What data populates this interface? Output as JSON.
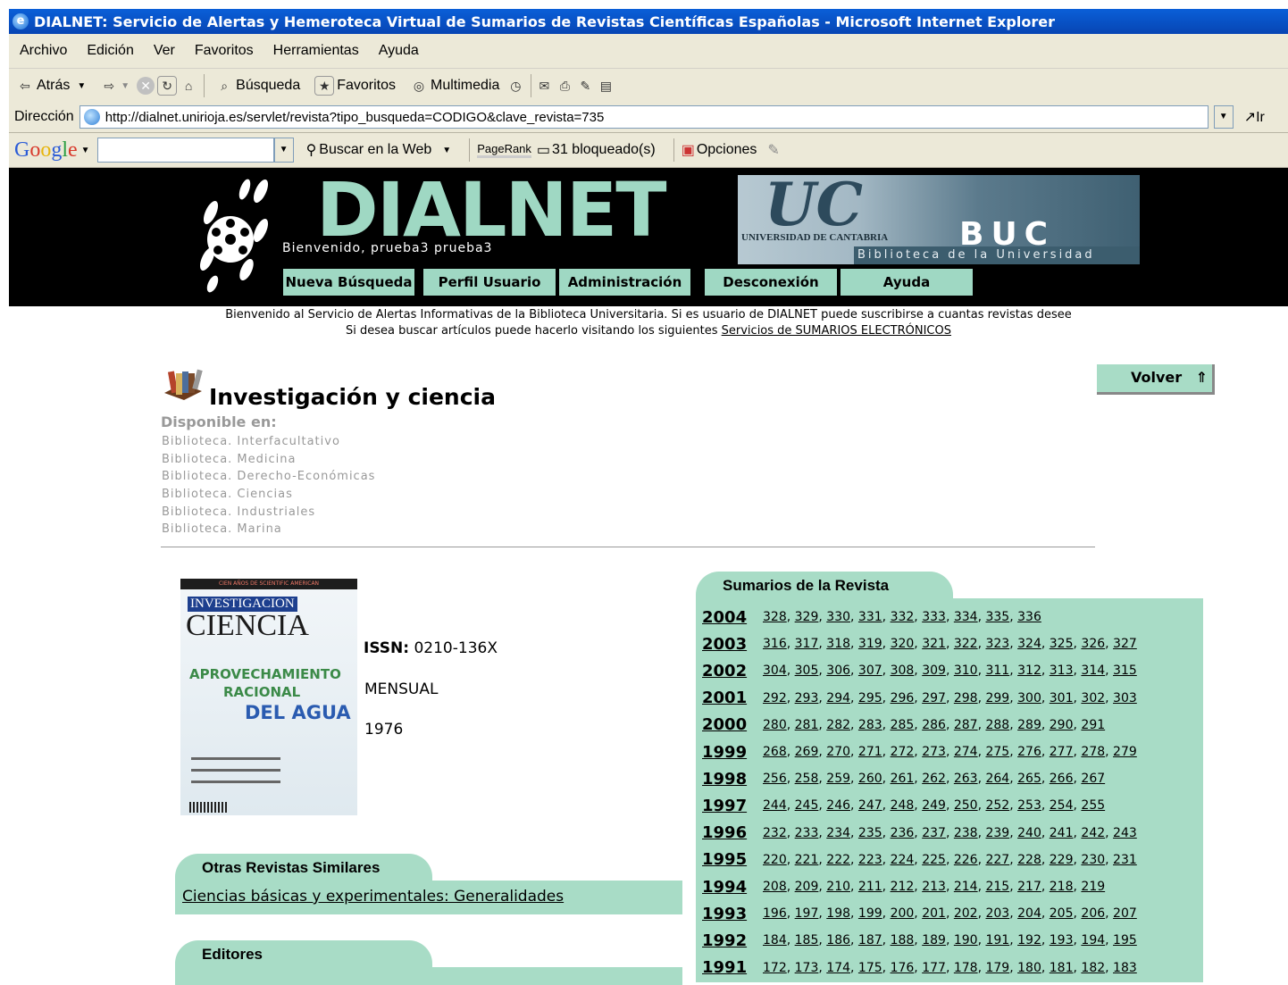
{
  "window": {
    "title": "DIALNET: Servicio de Alertas y Hemeroteca Virtual de Sumarios de Revistas Científicas Españolas - Microsoft Internet Explorer"
  },
  "menu": [
    "Archivo",
    "Edición",
    "Ver",
    "Favoritos",
    "Herramientas",
    "Ayuda"
  ],
  "toolbar": {
    "back": "Atrás",
    "search": "Búsqueda",
    "favorites": "Favoritos",
    "multimedia": "Multimedia"
  },
  "address": {
    "label": "Dirección",
    "url": "http://dialnet.unirioja.es/servlet/revista?tipo_busqueda=CODIGO&clave_revista=735",
    "go": "Ir"
  },
  "google": {
    "logo": "Google",
    "search_web": "Buscar en la Web",
    "pagerank": "PageRank",
    "blocked": "31 bloqueado(s)",
    "options": "Opciones"
  },
  "header": {
    "logo": "DIALNET",
    "welcome": "Bienvenido, prueba3 prueba3",
    "uc": "UC",
    "university": "UNIVERSIDAD DE CANTABRIA",
    "buc": "BUC",
    "library": "Biblioteca de la Universidad",
    "nav": [
      "Nueva Búsqueda",
      "Perfil Usuario",
      "Administración",
      "Desconexión",
      "Ayuda"
    ]
  },
  "intro": {
    "line1": "Bienvenido al Servicio de Alertas Informativas de la Biblioteca Universitaria. Si es usuario de DIALNET puede suscribirse a cuantas revistas desee",
    "line2_prefix": "Si desea buscar artículos puede hacerlo visitando los siguientes ",
    "line2_link": "Servicios de SUMARIOS ELECTRÓNICOS"
  },
  "journal": {
    "title": "Investigación y ciencia",
    "volver": "Volver",
    "available_label": "Disponible en:",
    "libraries": [
      "Biblioteca. Interfacultativo",
      "Biblioteca. Medicina",
      "Biblioteca. Derecho-Económicas",
      "Biblioteca. Ciencias",
      "Biblioteca. Industriales",
      "Biblioteca. Marina"
    ],
    "issn_label": "ISSN:",
    "issn": "0210-136X",
    "frequency": "MENSUAL",
    "start_year": "1976"
  },
  "cover": {
    "top": "CIEN AÑOS DE SCIENTIFIC AMERICAN",
    "investigacion": "INVESTIGACION",
    "ciencia": "CIENCIA",
    "apr": "APROVECHAMIENTO",
    "racional": "RACIONAL",
    "agua": "DEL AGUA"
  },
  "similar": {
    "title": "Otras Revistas Similares",
    "link": "Ciencias básicas y experimentales: Generalidades"
  },
  "editors": {
    "title": "Editores"
  },
  "summaries": {
    "title": "Sumarios de la Revista",
    "rows": [
      {
        "year": "2004",
        "issues": [
          "328",
          "329",
          "330",
          "331",
          "332",
          "333",
          "334",
          "335",
          "336"
        ]
      },
      {
        "year": "2003",
        "issues": [
          "316",
          "317",
          "318",
          "319",
          "320",
          "321",
          "322",
          "323",
          "324",
          "325",
          "326",
          "327"
        ]
      },
      {
        "year": "2002",
        "issues": [
          "304",
          "305",
          "306",
          "307",
          "308",
          "309",
          "310",
          "311",
          "312",
          "313",
          "314",
          "315"
        ]
      },
      {
        "year": "2001",
        "issues": [
          "292",
          "293",
          "294",
          "295",
          "296",
          "297",
          "298",
          "299",
          "300",
          "301",
          "302",
          "303"
        ]
      },
      {
        "year": "2000",
        "issues": [
          "280",
          "281",
          "282",
          "283",
          "285",
          "286",
          "287",
          "288",
          "289",
          "290",
          "291"
        ]
      },
      {
        "year": "1999",
        "issues": [
          "268",
          "269",
          "270",
          "271",
          "272",
          "273",
          "274",
          "275",
          "276",
          "277",
          "278",
          "279"
        ]
      },
      {
        "year": "1998",
        "issues": [
          "256",
          "258",
          "259",
          "260",
          "261",
          "262",
          "263",
          "264",
          "265",
          "266",
          "267"
        ]
      },
      {
        "year": "1997",
        "issues": [
          "244",
          "245",
          "246",
          "247",
          "248",
          "249",
          "250",
          "252",
          "253",
          "254",
          "255"
        ]
      },
      {
        "year": "1996",
        "issues": [
          "232",
          "233",
          "234",
          "235",
          "236",
          "237",
          "238",
          "239",
          "240",
          "241",
          "242",
          "243"
        ]
      },
      {
        "year": "1995",
        "issues": [
          "220",
          "221",
          "222",
          "223",
          "224",
          "225",
          "226",
          "227",
          "228",
          "229",
          "230",
          "231"
        ]
      },
      {
        "year": "1994",
        "issues": [
          "208",
          "209",
          "210",
          "211",
          "212",
          "213",
          "214",
          "215",
          "217",
          "218",
          "219"
        ]
      },
      {
        "year": "1993",
        "issues": [
          "196",
          "197",
          "198",
          "199",
          "200",
          "201",
          "202",
          "203",
          "204",
          "205",
          "206",
          "207"
        ]
      },
      {
        "year": "1992",
        "issues": [
          "184",
          "185",
          "186",
          "187",
          "188",
          "189",
          "190",
          "191",
          "192",
          "193",
          "194",
          "195"
        ]
      },
      {
        "year": "1991",
        "issues": [
          "172",
          "173",
          "174",
          "175",
          "176",
          "177",
          "178",
          "179",
          "180",
          "181",
          "182",
          "183"
        ]
      }
    ]
  },
  "colors": {
    "accent": "#a8dcc6",
    "logo": "#9fd8c3",
    "title_bar": "#0a5fd8"
  }
}
